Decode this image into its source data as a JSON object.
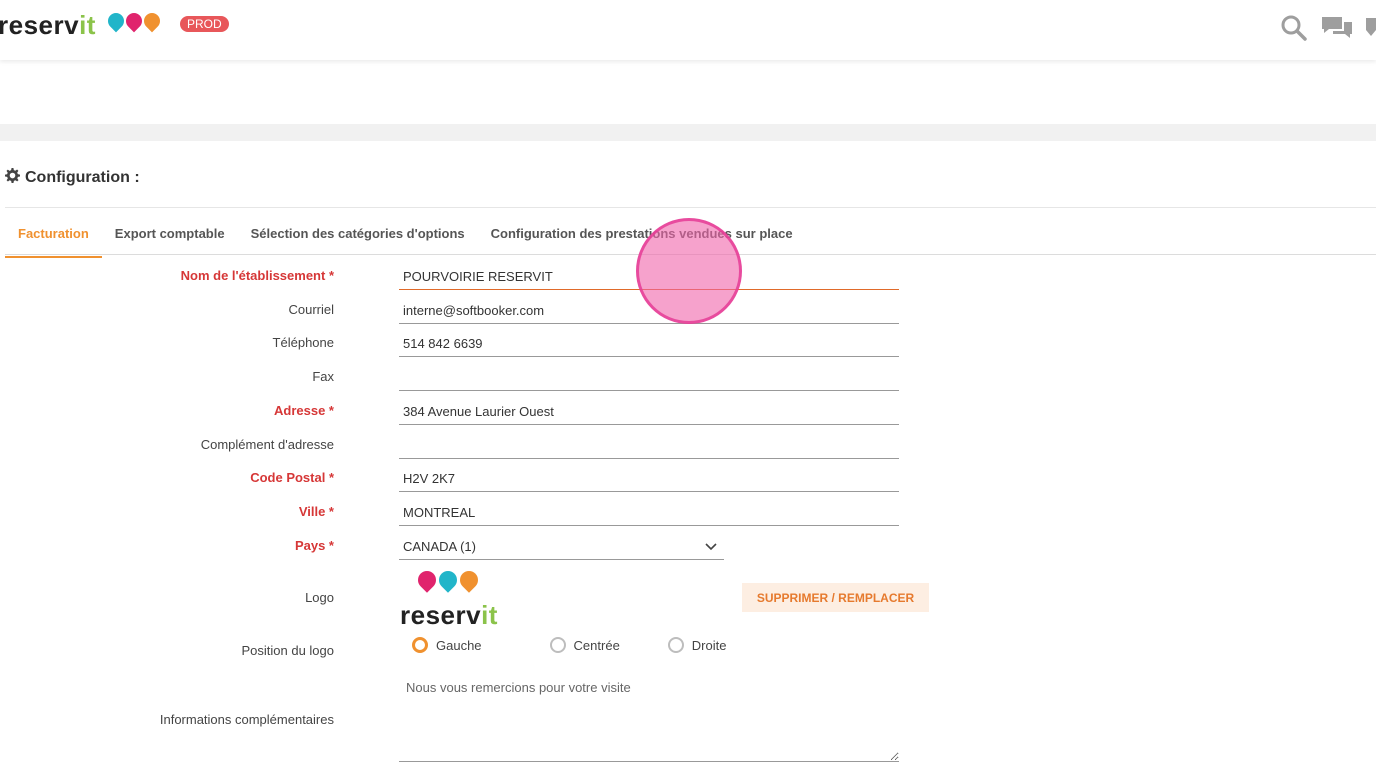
{
  "app": {
    "brand_main": "reserv",
    "brand_accent": "it",
    "env_badge": "PROD",
    "accent_color": "#f0912f",
    "required_color": "#d63737"
  },
  "topbar_icons": [
    "search-icon",
    "chat-icon",
    "notification-icon"
  ],
  "section": {
    "title": "Configuration :",
    "icon": "gear-icon"
  },
  "tabs": [
    {
      "label": "Facturation",
      "active": true
    },
    {
      "label": "Export comptable",
      "active": false
    },
    {
      "label": "Sélection des catégories d'options",
      "active": false
    },
    {
      "label": "Configuration des prestations vendues sur place",
      "active": false
    }
  ],
  "form": {
    "nom": {
      "label": "Nom de l'établissement *",
      "value": "POURVOIRIE RESERVIT"
    },
    "courriel": {
      "label": "Courriel",
      "value": "interne@softbooker.com"
    },
    "telephone": {
      "label": "Téléphone",
      "value": "514 842 6639"
    },
    "fax": {
      "label": "Fax",
      "value": ""
    },
    "adresse": {
      "label": "Adresse *",
      "value": "384 Avenue Laurier Ouest"
    },
    "complement": {
      "label": "Complément d'adresse",
      "value": ""
    },
    "code_postal": {
      "label": "Code Postal *",
      "value": "H2V 2K7"
    },
    "ville": {
      "label": "Ville *",
      "value": "MONTREAL"
    },
    "pays": {
      "label": "Pays *",
      "value": "CANADA (1)"
    },
    "logo": {
      "label": "Logo",
      "button": "SUPPRIMER / REMPLACER",
      "brand_main": "reserv",
      "brand_accent": "it"
    },
    "position": {
      "label": "Position du logo",
      "options": [
        "Gauche",
        "Centrée",
        "Droite"
      ],
      "selected": "Gauche"
    },
    "infos": {
      "label": "Informations complémentaires",
      "value": "Nous vous remercions pour votre visite"
    }
  }
}
